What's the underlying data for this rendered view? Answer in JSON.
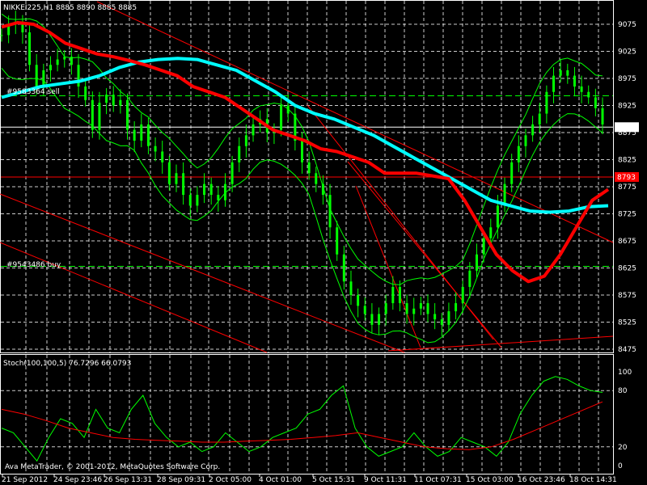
{
  "chart_data": [
    {
      "type": "line",
      "title": "NIKKEI225,H1  8885 8890 8885 8885",
      "ylim": [
        8450,
        9100
      ],
      "y_ticks": [
        9075,
        9025,
        8975,
        8925,
        8875,
        8825,
        8775,
        8725,
        8675,
        8625,
        8575,
        8525,
        8475
      ],
      "current_price_label": "8885",
      "marked_level_label": "8793",
      "object_labels": [
        "#9583364 sell",
        "#9543486 buy"
      ],
      "grid": "dashed",
      "colors": {
        "background": "#000000",
        "candles": "#00ff00",
        "ma_fast": "#ff0000",
        "ma_slow": "#00ffff",
        "bands": "#00ff00",
        "levels": "#ff0000"
      },
      "candles_close_approx": [
        9055,
        9075,
        9080,
        9060,
        9000,
        8960,
        8990,
        9000,
        9010,
        9015,
        9000,
        8960,
        8935,
        8880,
        8930,
        8945,
        8925,
        8935,
        8880,
        8860,
        8890,
        8850,
        8840,
        8820,
        8780,
        8800,
        8760,
        8740,
        8760,
        8780,
        8760,
        8750,
        8780,
        8820,
        8850,
        8870,
        8890,
        8900,
        8875,
        8880,
        8925,
        8910,
        8860,
        8820,
        8800,
        8780,
        8760,
        8700,
        8650,
        8600,
        8575,
        8555,
        8540,
        8520,
        8540,
        8560,
        8590,
        8560,
        8540,
        8550,
        8560,
        8540,
        8530,
        8520,
        8545,
        8560,
        8590,
        8620,
        8650,
        8680,
        8700,
        8740,
        8780,
        8820,
        8850,
        8870,
        8890,
        8910,
        8950,
        8980,
        8990,
        8980,
        8960,
        8950,
        8940,
        8920,
        8890
      ],
      "series": [
        {
          "values": [
            9070,
            9078,
            9075,
            9060,
            9040,
            9030,
            9020,
            9015,
            9008,
            9000,
            8990,
            8980,
            8960,
            8950,
            8940,
            8920,
            8900,
            8880,
            8870,
            8860,
            8845,
            8840,
            8830,
            8820,
            8800,
            8800,
            8800,
            8795,
            8790,
            8750,
            8700,
            8650,
            8620,
            8600,
            8610,
            8650,
            8700,
            8750,
            8770
          ]
        },
        {
          "values": [
            8940,
            8950,
            8960,
            8965,
            8970,
            8980,
            8995,
            9005,
            9010,
            9012,
            9010,
            9000,
            8990,
            8970,
            8950,
            8925,
            8910,
            8900,
            8885,
            8870,
            8850,
            8830,
            8810,
            8790,
            8770,
            8750,
            8740,
            8730,
            8728,
            8730,
            8738,
            8740
          ]
        }
      ]
    },
    {
      "type": "line",
      "title": "Stoch(100,100,5) 76.7296 66.0793",
      "ylim": [
        0,
        100
      ],
      "y_ticks": [
        100,
        80,
        20,
        0
      ],
      "series": [
        {
          "values": [
            40,
            35,
            20,
            5,
            30,
            50,
            45,
            30,
            60,
            40,
            35,
            60,
            75,
            45,
            30,
            20,
            25,
            15,
            20,
            35,
            25,
            15,
            20,
            30,
            35,
            40,
            55,
            60,
            75,
            85,
            40,
            20,
            10,
            15,
            20,
            35,
            20,
            10,
            15,
            30,
            25,
            20,
            10,
            25,
            55,
            75,
            90,
            95,
            92,
            85,
            80,
            78
          ]
        },
        {
          "values": [
            60,
            55,
            48,
            40,
            35,
            30,
            28,
            27,
            26,
            25,
            25,
            26,
            27,
            28,
            30,
            32,
            35,
            30,
            25,
            20,
            18,
            17,
            20,
            28,
            38,
            48,
            58,
            68
          ]
        }
      ]
    }
  ],
  "x_labels": [
    "21 Sep 2012",
    "24 Sep 23:46",
    "26 Sep 13:31",
    "28 Sep 09:31",
    "2 Oct 05:00",
    "4 Oct 01:00",
    "5 Oct 15:31",
    "9 Oct 11:31",
    "11 Oct 07:31",
    "15 Oct 03:00",
    "16 Oct 23:46",
    "18 Oct 14:31"
  ],
  "copyright": "Ava MetaTrader, © 2001-2012, MetaQuotes Software Corp."
}
